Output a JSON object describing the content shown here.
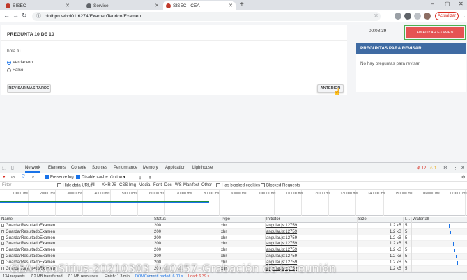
{
  "browser": {
    "tabs": [
      {
        "title": "SISEC",
        "favicon_color": "#c0392b",
        "active": false
      },
      {
        "title": "Service",
        "favicon_color": "#5f6368",
        "active": false
      },
      {
        "title": "SISEC - CEA",
        "favicon_color": "#c0392b",
        "active": true
      }
    ],
    "new_tab": "+",
    "url": "oinlbpruwbbi01:6274/ExamenTeorico/Examen",
    "update_button": "Actualizar"
  },
  "exam": {
    "question_title": "PREGUNTA 10 DE 10",
    "question_text": "hola tu",
    "options": [
      {
        "label": "Verdadero",
        "selected": true
      },
      {
        "label": "Falso",
        "selected": false
      }
    ],
    "review_later_button": "REVISAR MÁS TARDE",
    "previous_button": "ANTERIOR",
    "timer": "00:08:39",
    "finish_button": "FINALIZAR EXAMEN",
    "review_panel_title": "PREGUNTAS PARA REVISAR",
    "review_panel_empty": "No hay preguntas para revisar"
  },
  "devtools": {
    "tabs": [
      "Network",
      "Elements",
      "Console",
      "Sources",
      "Performance",
      "Memory",
      "Application",
      "Lighthouse"
    ],
    "active_tab": "Network",
    "error_count": "12",
    "warning_count": "1",
    "controls": {
      "preserve_log": "Preserve log",
      "disable_cache": "Disable cache",
      "throttle": "Online"
    },
    "filter": {
      "placeholder": "Filter",
      "hide_data_urls": "Hide data URLs",
      "types": [
        "All",
        "XHR",
        "JS",
        "CSS",
        "Img",
        "Media",
        "Font",
        "Doc",
        "WS",
        "Manifest",
        "Other"
      ],
      "has_blocked_cookies": "Has blocked cookies",
      "blocked_requests": "Blocked Requests"
    },
    "timeline_ticks": [
      "10000 ms",
      "20000 ms",
      "30000 ms",
      "40000 ms",
      "50000 ms",
      "60000 ms",
      "70000 ms",
      "80000 ms",
      "90000 ms",
      "100000 ms",
      "110000 ms",
      "120000 ms",
      "130000 ms",
      "140000 ms",
      "150000 ms",
      "160000 ms",
      "170000 ms"
    ],
    "columns": {
      "name": "Name",
      "status": "Status",
      "type": "Type",
      "initiator": "Initiator",
      "size": "Size",
      "time": "T...",
      "waterfall": "Waterfall"
    },
    "rows": [
      {
        "name": "GuardarResultadoExamen",
        "status": "200",
        "type": "xhr",
        "initiator": "angular.js:12759",
        "size": "1.2 kB",
        "time": "5"
      },
      {
        "name": "GuardarResultadoExamen",
        "status": "200",
        "type": "xhr",
        "initiator": "angular.js:12759",
        "size": "1.2 kB",
        "time": "5"
      },
      {
        "name": "GuardarResultadoExamen",
        "status": "200",
        "type": "xhr",
        "initiator": "angular.js:12759",
        "size": "1.2 kB",
        "time": "5"
      },
      {
        "name": "GuardarResultadoExamen",
        "status": "200",
        "type": "xhr",
        "initiator": "angular.js:12759",
        "size": "1.2 kB",
        "time": "5"
      },
      {
        "name": "GuardarResultadoExamen",
        "status": "200",
        "type": "xhr",
        "initiator": "angular.js:12759",
        "size": "1.2 kB",
        "time": "5"
      },
      {
        "name": "GuardarResultadoExamen",
        "status": "200",
        "type": "xhr",
        "initiator": "angular.js:12759",
        "size": "1.2 kB",
        "time": "5"
      },
      {
        "name": "GuardarResultadoExamen",
        "status": "200",
        "type": "xhr",
        "initiator": "angular.js:12759",
        "size": "1.2 kB",
        "time": "5"
      },
      {
        "name": "GuardarResultadoExamen",
        "status": "200",
        "type": "xhr",
        "initiator": "angular.js:12759",
        "size": "1.2 kB",
        "time": "5"
      }
    ],
    "status_bar": {
      "requests": "134 requests",
      "transferred": "7.2 MB transferred",
      "resources": "7.1 MB resources",
      "finish": "Finish: 1.3 min",
      "dom_loaded": "DOMContentLoaded: 6.00 s",
      "load": "Load: 6.39 s"
    }
  },
  "watermark": "CEA-NeoSirius-20210303_140457-Grabación de la reunión",
  "colors": {
    "finish_button": "#e55353",
    "review_header": "#3f6ba3",
    "highlight_outline": "#4caf50",
    "update_button": "#d93025"
  }
}
